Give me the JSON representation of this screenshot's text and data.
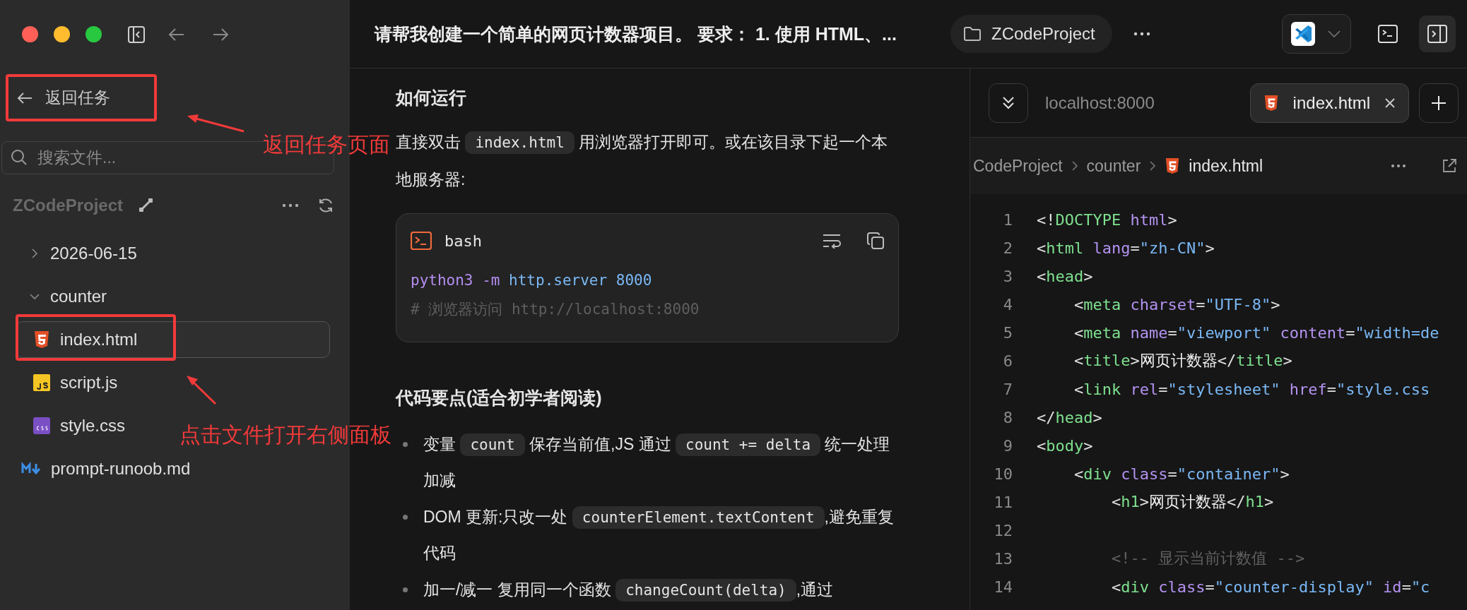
{
  "sidebar": {
    "back_button": {
      "label": "返回任务"
    },
    "search": {
      "placeholder": "搜索文件..."
    },
    "project": {
      "name": "ZCodeProject"
    },
    "tree": [
      {
        "label": "2026-06-15",
        "kind": "folder",
        "expanded": false,
        "selected": false
      },
      {
        "label": "counter",
        "kind": "folder",
        "expanded": true,
        "selected": false,
        "children": [
          {
            "label": "index.html",
            "kind": "html",
            "selected": true
          },
          {
            "label": "script.js",
            "kind": "js",
            "selected": false
          },
          {
            "label": "style.css",
            "kind": "css",
            "selected": false
          }
        ]
      },
      {
        "label": "prompt-runoob.md",
        "kind": "md",
        "selected": false
      }
    ]
  },
  "topbar": {
    "title": "请帮我创建一个简单的网页计数器项目。 要求： 1. 使用 HTML、...",
    "project_chip": "ZCodeProject"
  },
  "chat": {
    "blocks": [
      {
        "kind": "heading",
        "text": "如何运行"
      },
      {
        "kind": "paragraph",
        "segments": [
          {
            "kind": "text",
            "text": "直接双击 "
          },
          {
            "kind": "code",
            "text": "index.html"
          },
          {
            "kind": "text",
            "text": " 用浏览器打开即可。或在该目录下起一个本地服务器:"
          }
        ]
      },
      {
        "kind": "codeblock",
        "language": "bash",
        "lines": [
          [
            {
              "kind": "cmd",
              "text": "python3 -m"
            },
            {
              "kind": "arg",
              "text": " http.server 8000"
            }
          ],
          [
            {
              "kind": "comment",
              "text": "# 浏览器访问 http://localhost:8000"
            }
          ]
        ]
      },
      {
        "kind": "heading",
        "text": "代码要点(适合初学者阅读)"
      },
      {
        "kind": "list",
        "items": [
          [
            {
              "kind": "text",
              "text": "变量 "
            },
            {
              "kind": "code",
              "text": "count"
            },
            {
              "kind": "text",
              "text": " 保存当前值,JS 通过 "
            },
            {
              "kind": "code",
              "text": "count += delta"
            },
            {
              "kind": "text",
              "text": " 统一处理加减"
            }
          ],
          [
            {
              "kind": "text",
              "text": "DOM 更新:只改一处 "
            },
            {
              "kind": "code",
              "text": "counterElement.textContent"
            },
            {
              "kind": "text",
              "text": ",避免重复代码"
            }
          ],
          [
            {
              "kind": "text",
              "text": "加一/减一 复用同一个函数 "
            },
            {
              "kind": "code",
              "text": "changeCount(delta)"
            },
            {
              "kind": "text",
              "text": ",通过"
            }
          ]
        ]
      }
    ]
  },
  "editor": {
    "address": "localhost:8000",
    "tabs": [
      {
        "label": "index.html",
        "kind": "html",
        "selected": true
      }
    ],
    "breadcrumb": [
      {
        "label": "CodeProject"
      },
      {
        "label": "counter"
      },
      {
        "label": "index.html",
        "kind": "html"
      }
    ],
    "lines": [
      {
        "number": "1",
        "tokens": [
          {
            "kind": "p",
            "text": "<!"
          },
          {
            "kind": "tag",
            "text": "DOCTYPE"
          },
          {
            "kind": "attr",
            "text": " html"
          },
          {
            "kind": "p",
            "text": ">"
          }
        ]
      },
      {
        "number": "2",
        "tokens": [
          {
            "kind": "p",
            "text": "<"
          },
          {
            "kind": "tag",
            "text": "html"
          },
          {
            "kind": "attr",
            "text": " lang"
          },
          {
            "kind": "p",
            "text": "="
          },
          {
            "kind": "str",
            "text": "\"zh-CN\""
          },
          {
            "kind": "p",
            "text": ">"
          }
        ]
      },
      {
        "number": "3",
        "tokens": [
          {
            "kind": "p",
            "text": "<"
          },
          {
            "kind": "tag",
            "text": "head"
          },
          {
            "kind": "p",
            "text": ">"
          }
        ]
      },
      {
        "number": "4",
        "tokens": [
          {
            "kind": "p",
            "text": "    <"
          },
          {
            "kind": "tag",
            "text": "meta"
          },
          {
            "kind": "attr",
            "text": " charset"
          },
          {
            "kind": "p",
            "text": "="
          },
          {
            "kind": "str",
            "text": "\"UTF-8\""
          },
          {
            "kind": "p",
            "text": ">"
          }
        ]
      },
      {
        "number": "5",
        "tokens": [
          {
            "kind": "p",
            "text": "    <"
          },
          {
            "kind": "tag",
            "text": "meta"
          },
          {
            "kind": "attr",
            "text": " name"
          },
          {
            "kind": "p",
            "text": "="
          },
          {
            "kind": "str",
            "text": "\"viewport\""
          },
          {
            "kind": "attr",
            "text": " content"
          },
          {
            "kind": "p",
            "text": "="
          },
          {
            "kind": "str",
            "text": "\"width=de"
          }
        ]
      },
      {
        "number": "6",
        "tokens": [
          {
            "kind": "p",
            "text": "    <"
          },
          {
            "kind": "tag",
            "text": "title"
          },
          {
            "kind": "p",
            "text": ">"
          },
          {
            "kind": "text",
            "text": "网页计数器"
          },
          {
            "kind": "p",
            "text": "</"
          },
          {
            "kind": "tag",
            "text": "title"
          },
          {
            "kind": "p",
            "text": ">"
          }
        ]
      },
      {
        "number": "7",
        "tokens": [
          {
            "kind": "p",
            "text": "    <"
          },
          {
            "kind": "tag",
            "text": "link"
          },
          {
            "kind": "attr",
            "text": " rel"
          },
          {
            "kind": "p",
            "text": "="
          },
          {
            "kind": "str",
            "text": "\"stylesheet\""
          },
          {
            "kind": "attr",
            "text": " href"
          },
          {
            "kind": "p",
            "text": "="
          },
          {
            "kind": "str",
            "text": "\"style.css"
          }
        ]
      },
      {
        "number": "8",
        "tokens": [
          {
            "kind": "p",
            "text": "</"
          },
          {
            "kind": "tag",
            "text": "head"
          },
          {
            "kind": "p",
            "text": ">"
          }
        ]
      },
      {
        "number": "9",
        "tokens": [
          {
            "kind": "p",
            "text": "<"
          },
          {
            "kind": "tag",
            "text": "body"
          },
          {
            "kind": "p",
            "text": ">"
          }
        ]
      },
      {
        "number": "10",
        "tokens": [
          {
            "kind": "p",
            "text": "    <"
          },
          {
            "kind": "tag",
            "text": "div"
          },
          {
            "kind": "attr",
            "text": " class"
          },
          {
            "kind": "p",
            "text": "="
          },
          {
            "kind": "str",
            "text": "\"container\""
          },
          {
            "kind": "p",
            "text": ">"
          }
        ]
      },
      {
        "number": "11",
        "tokens": [
          {
            "kind": "p",
            "text": "        <"
          },
          {
            "kind": "tag",
            "text": "h1"
          },
          {
            "kind": "p",
            "text": ">"
          },
          {
            "kind": "text",
            "text": "网页计数器"
          },
          {
            "kind": "p",
            "text": "</"
          },
          {
            "kind": "tag",
            "text": "h1"
          },
          {
            "kind": "p",
            "text": ">"
          }
        ]
      },
      {
        "number": "12"
      },
      {
        "number": "13",
        "tokens": [
          {
            "kind": "comment",
            "text": "        <!-- 显示当前计数值 -->"
          }
        ]
      },
      {
        "number": "14",
        "tokens": [
          {
            "kind": "p",
            "text": "        <"
          },
          {
            "kind": "tag",
            "text": "div"
          },
          {
            "kind": "attr",
            "text": " class"
          },
          {
            "kind": "p",
            "text": "="
          },
          {
            "kind": "str",
            "text": "\"counter-display\""
          },
          {
            "kind": "attr",
            "text": " id"
          },
          {
            "kind": "p",
            "text": "="
          },
          {
            "kind": "str",
            "text": "\"c"
          }
        ]
      }
    ]
  },
  "annotations": [
    {
      "text": "返回任务页面"
    },
    {
      "text": "点击文件打开右侧面板"
    }
  ]
}
